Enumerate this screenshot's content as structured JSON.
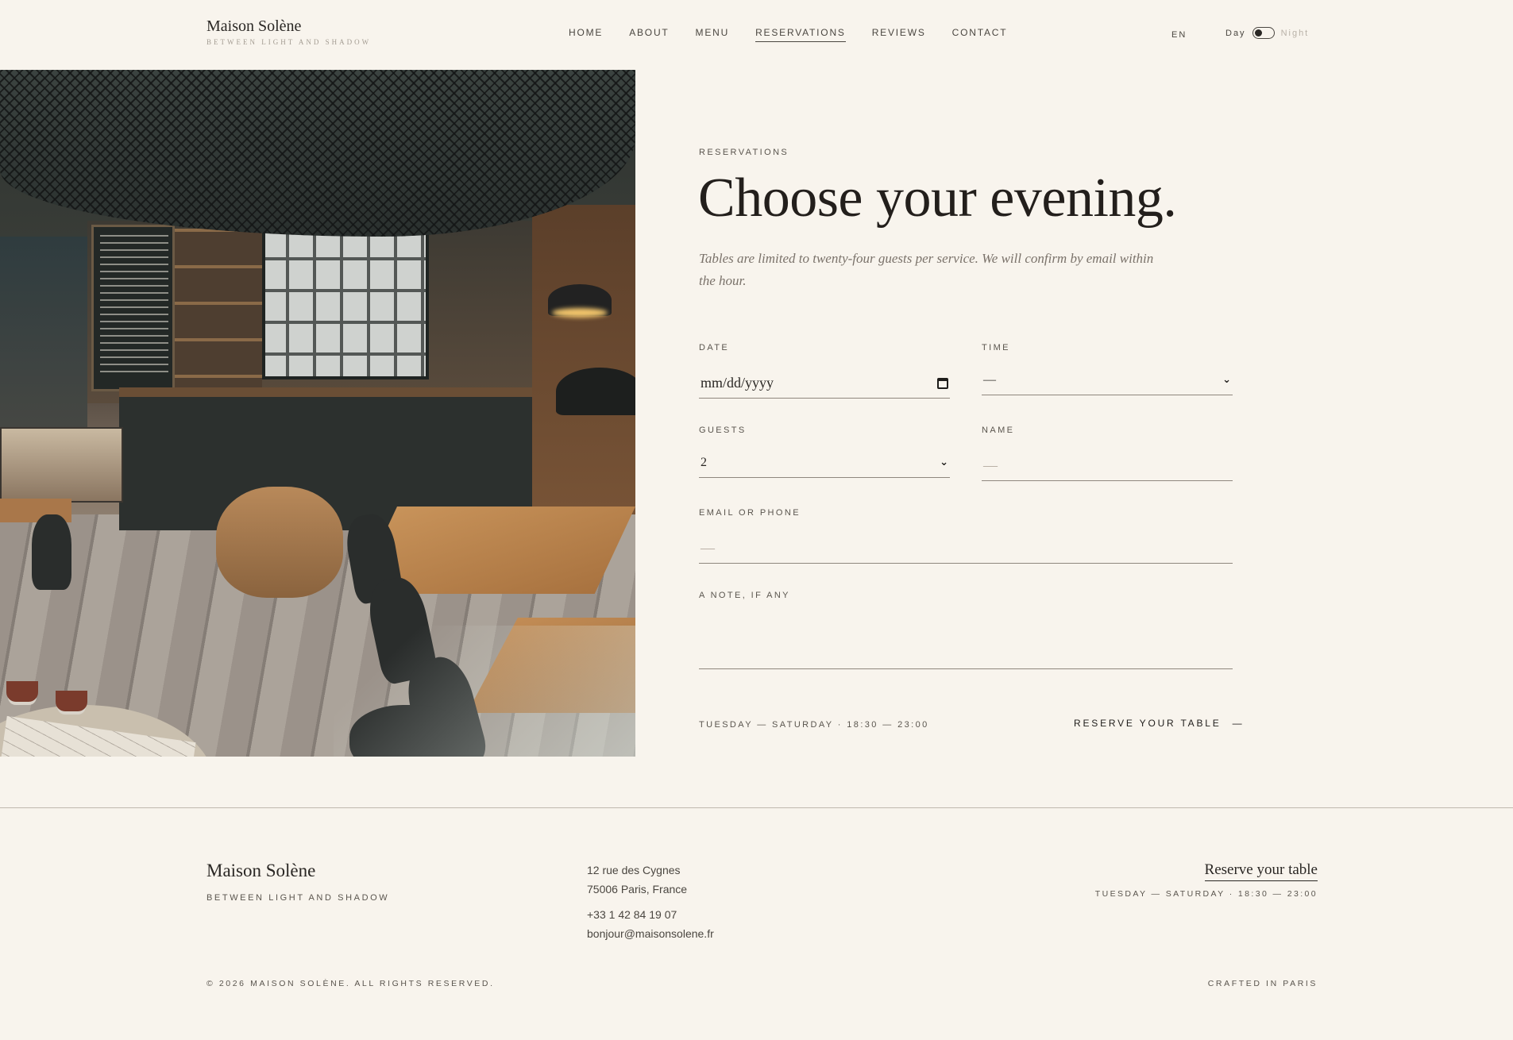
{
  "brand": {
    "name": "Maison Solène",
    "tagline": "Between light and shadow"
  },
  "nav": {
    "items": [
      {
        "label": "Home"
      },
      {
        "label": "About"
      },
      {
        "label": "Menu"
      },
      {
        "label": "Reservations",
        "active": true
      },
      {
        "label": "Reviews"
      },
      {
        "label": "Contact"
      }
    ],
    "language": "EN",
    "theme": {
      "day_label": "Day",
      "night_label": "Night",
      "selected": "Day"
    }
  },
  "hero_image": {
    "alt": "Café interior with wooden tables and a coffee counter"
  },
  "reservation": {
    "eyebrow": "Reservations",
    "title": "Choose your evening.",
    "lede": "Tables are limited to twenty-four guests per service. We will confirm by email within the hour.",
    "fields": {
      "date": {
        "label": "Date",
        "placeholder": "mm/dd/yyyy"
      },
      "time": {
        "label": "Time",
        "value": "—"
      },
      "guests": {
        "label": "Guests",
        "value": "2"
      },
      "name": {
        "label": "Name",
        "placeholder": "—"
      },
      "contact": {
        "label": "Email or phone",
        "placeholder": "—"
      },
      "note": {
        "label": "A note, if any",
        "placeholder": ""
      }
    },
    "hours": "Tuesday — Saturday · 18:30 — 23:00",
    "submit_label": "Reserve your table",
    "submit_arrow": "—"
  },
  "footer": {
    "brand": "Maison Solène",
    "tagline": "Between light and shadow",
    "address_line1": "12 rue des Cygnes",
    "address_line2": "75006 Paris, France",
    "phone": "+33 1 42 84 19 07",
    "email": "bonjour@maisonsolene.fr",
    "reserve_link": "Reserve your table",
    "hours": "Tuesday — Saturday · 18:30 — 23:00",
    "copyright": "© 2026 Maison Solène. All rights reserved.",
    "crafted": "Crafted in Paris"
  },
  "colors": {
    "background": "#f8f4ed",
    "text": "#2a2724",
    "muted": "#7a726a",
    "rule": "#8f877e"
  }
}
